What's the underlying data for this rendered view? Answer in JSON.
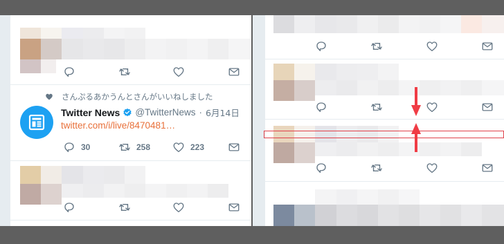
{
  "liked_notice": {
    "text": "さんぷるあかうんとさんがいいねしました"
  },
  "tweet": {
    "name": "Twitter News",
    "handle": "@TwitterNews",
    "separator": "·",
    "date": "6月14日",
    "link": "twitter.com/i/live/8470481…",
    "replies": "30",
    "retweets": "258",
    "likes": "223"
  },
  "colors": {
    "accent": "#1da1f2",
    "link": "#e8703a",
    "icon_gray": "#657786",
    "highlight_border": "#e0424b",
    "arrow": "#f03c45"
  },
  "icons": [
    "reply-icon",
    "retweet-icon",
    "like-icon",
    "message-icon",
    "heart-icon",
    "verified-icon",
    "news-icon",
    "arrow-down-icon",
    "arrow-up-icon"
  ]
}
